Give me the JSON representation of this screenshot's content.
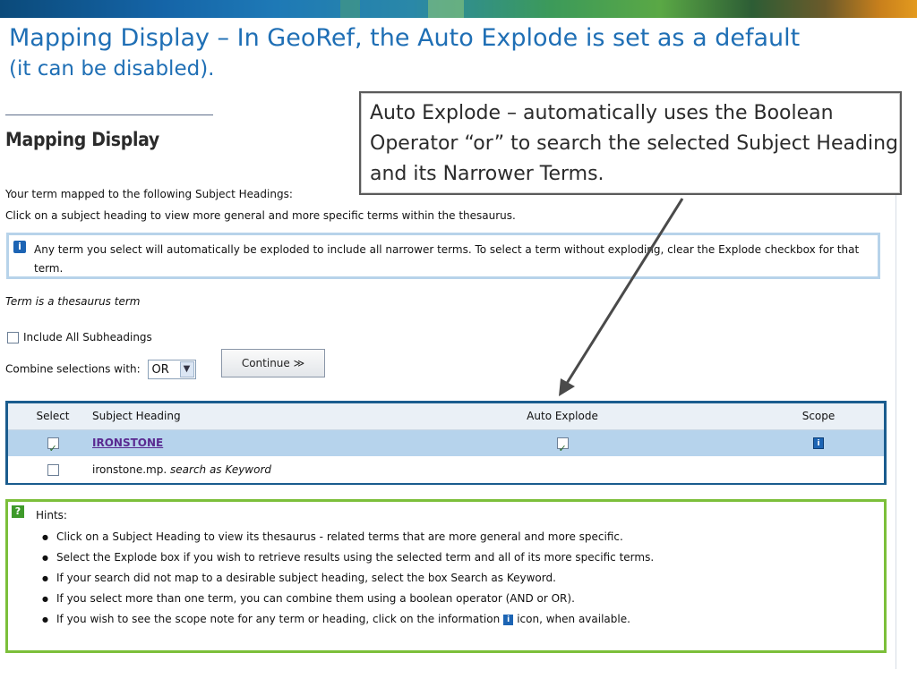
{
  "slide": {
    "title_line1": "Mapping Display – In GeoRef, the Auto Explode is set as a default",
    "title_line2": "(it can be disabled)."
  },
  "callout": {
    "text": "Auto Explode – automatically uses the Boolean Operator “or” to search the selected Subject Heading and its Narrower Terms."
  },
  "page": {
    "heading": "Mapping Display",
    "mapped_text": "Your term mapped to the following Subject Headings:",
    "click_text": "Click on a subject heading to view more general and more specific terms within the thesaurus.",
    "info_text": "Any term you select will automatically be exploded to include all narrower terms. To select a term without exploding, clear the Explode checkbox for that term.",
    "thesaurus_note": "Term is a thesaurus term",
    "include_all_label": "Include All Subheadings",
    "combine_label": "Combine selections with:",
    "combine_value": "OR",
    "continue_label": "Continue ≫"
  },
  "table": {
    "headers": {
      "select": "Select",
      "heading": "Subject Heading",
      "auto": "Auto Explode",
      "scope": "Scope"
    },
    "rows": [
      {
        "heading": "IRONSTONE",
        "select_checked": true,
        "auto_checked": true,
        "scope_icon": "i"
      },
      {
        "heading": "ironstone.mp.",
        "keyword": "search as Keyword",
        "select_checked": false
      }
    ]
  },
  "hints": {
    "title": "Hints:",
    "items": [
      "Click on a Subject Heading to view its thesaurus - related terms that are more general and more specific.",
      "Select the Explode box if you wish to retrieve results using the selected term and all of its more specific terms.",
      "If your search did not map to a desirable subject heading, select the box Search as Keyword.",
      "If you select more than one term, you can combine them using a boolean operator (AND or OR)."
    ],
    "last_before": "If you wish to see the scope note for any term or heading, click on the information",
    "last_after": "icon, when available."
  },
  "colors": {
    "title_blue": "#1f6fb5",
    "table_border": "#1a5c8e",
    "selected_row": "#b6d3ec",
    "hints_border": "#7cbf3a",
    "link_purple": "#5a2a91"
  }
}
